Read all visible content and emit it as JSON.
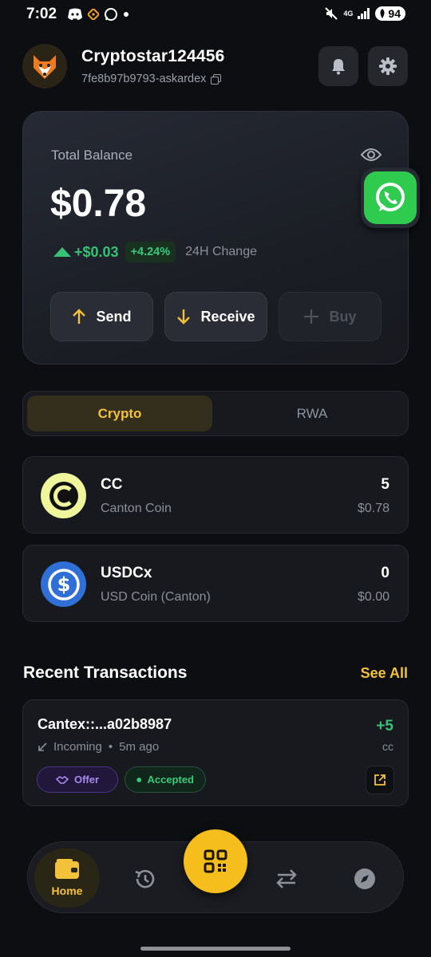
{
  "status_bar": {
    "time": "7:02",
    "network": "4G",
    "battery": "94"
  },
  "header": {
    "avatar_icon": "fox-avatar-icon",
    "username": "Cryptostar124456",
    "address": "7fe8b97b9793-askardex"
  },
  "balance": {
    "label": "Total Balance",
    "value": "$0.78",
    "change_amount": "+$0.03",
    "change_percent": "+4.24%",
    "change_label": "24H Change",
    "actions": [
      {
        "label": "Send",
        "icon": "arrow-up-icon"
      },
      {
        "label": "Receive",
        "icon": "arrow-down-icon"
      },
      {
        "label": "Buy",
        "icon": "plus-icon",
        "disabled": true
      }
    ]
  },
  "tabs": [
    {
      "label": "Crypto",
      "active": true
    },
    {
      "label": "RWA",
      "active": false
    }
  ],
  "assets": [
    {
      "symbol": "CC",
      "name": "Canton Coin",
      "quantity": "5",
      "usd": "$0.78"
    },
    {
      "symbol": "USDCx",
      "name": "USD Coin (Canton)",
      "quantity": "0",
      "usd": "$0.00"
    }
  ],
  "recent": {
    "title": "Recent Transactions",
    "see_all": "See All",
    "transactions": [
      {
        "id": "Cantex::...a02b8987",
        "direction": "Incoming",
        "separator": "•",
        "time": "5m ago",
        "amount": "+5",
        "unit": "cc",
        "tags": [
          "Offer",
          "Accepted"
        ]
      }
    ]
  },
  "nav": {
    "home_label": "Home"
  },
  "colors": {
    "accent": "#f3c23a",
    "positive": "#35c274",
    "background": "#0d0e11",
    "card": "#17191e"
  }
}
